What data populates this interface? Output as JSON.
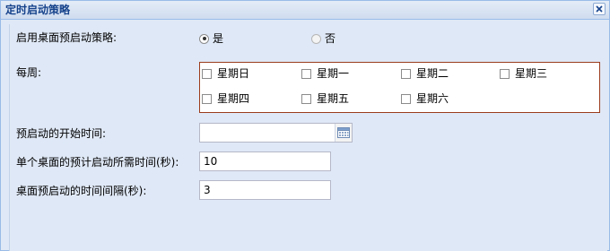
{
  "window": {
    "title": "定时启动策略",
    "close_icon": "close-icon"
  },
  "form": {
    "enable": {
      "label": "启用桌面预启动策略:",
      "options": [
        "是",
        "否"
      ],
      "selected": "是"
    },
    "weekly": {
      "label": "每周:",
      "days": [
        "星期日",
        "星期一",
        "星期二",
        "星期三",
        "星期四",
        "星期五",
        "星期六"
      ],
      "checked": []
    },
    "start_time": {
      "label": "预启动的开始时间:",
      "value": "",
      "trigger_icon": "calendar-icon"
    },
    "duration": {
      "label": "单个桌面的预计启动所需时间(秒):",
      "value": "10"
    },
    "interval": {
      "label": "桌面预启动的时间间隔(秒):",
      "value": "3"
    }
  },
  "colors": {
    "title_text": "#15428b",
    "panel_bg": "#dfe8f6",
    "border": "#99bbe8",
    "weekbox_border": "#9b3b1c"
  }
}
